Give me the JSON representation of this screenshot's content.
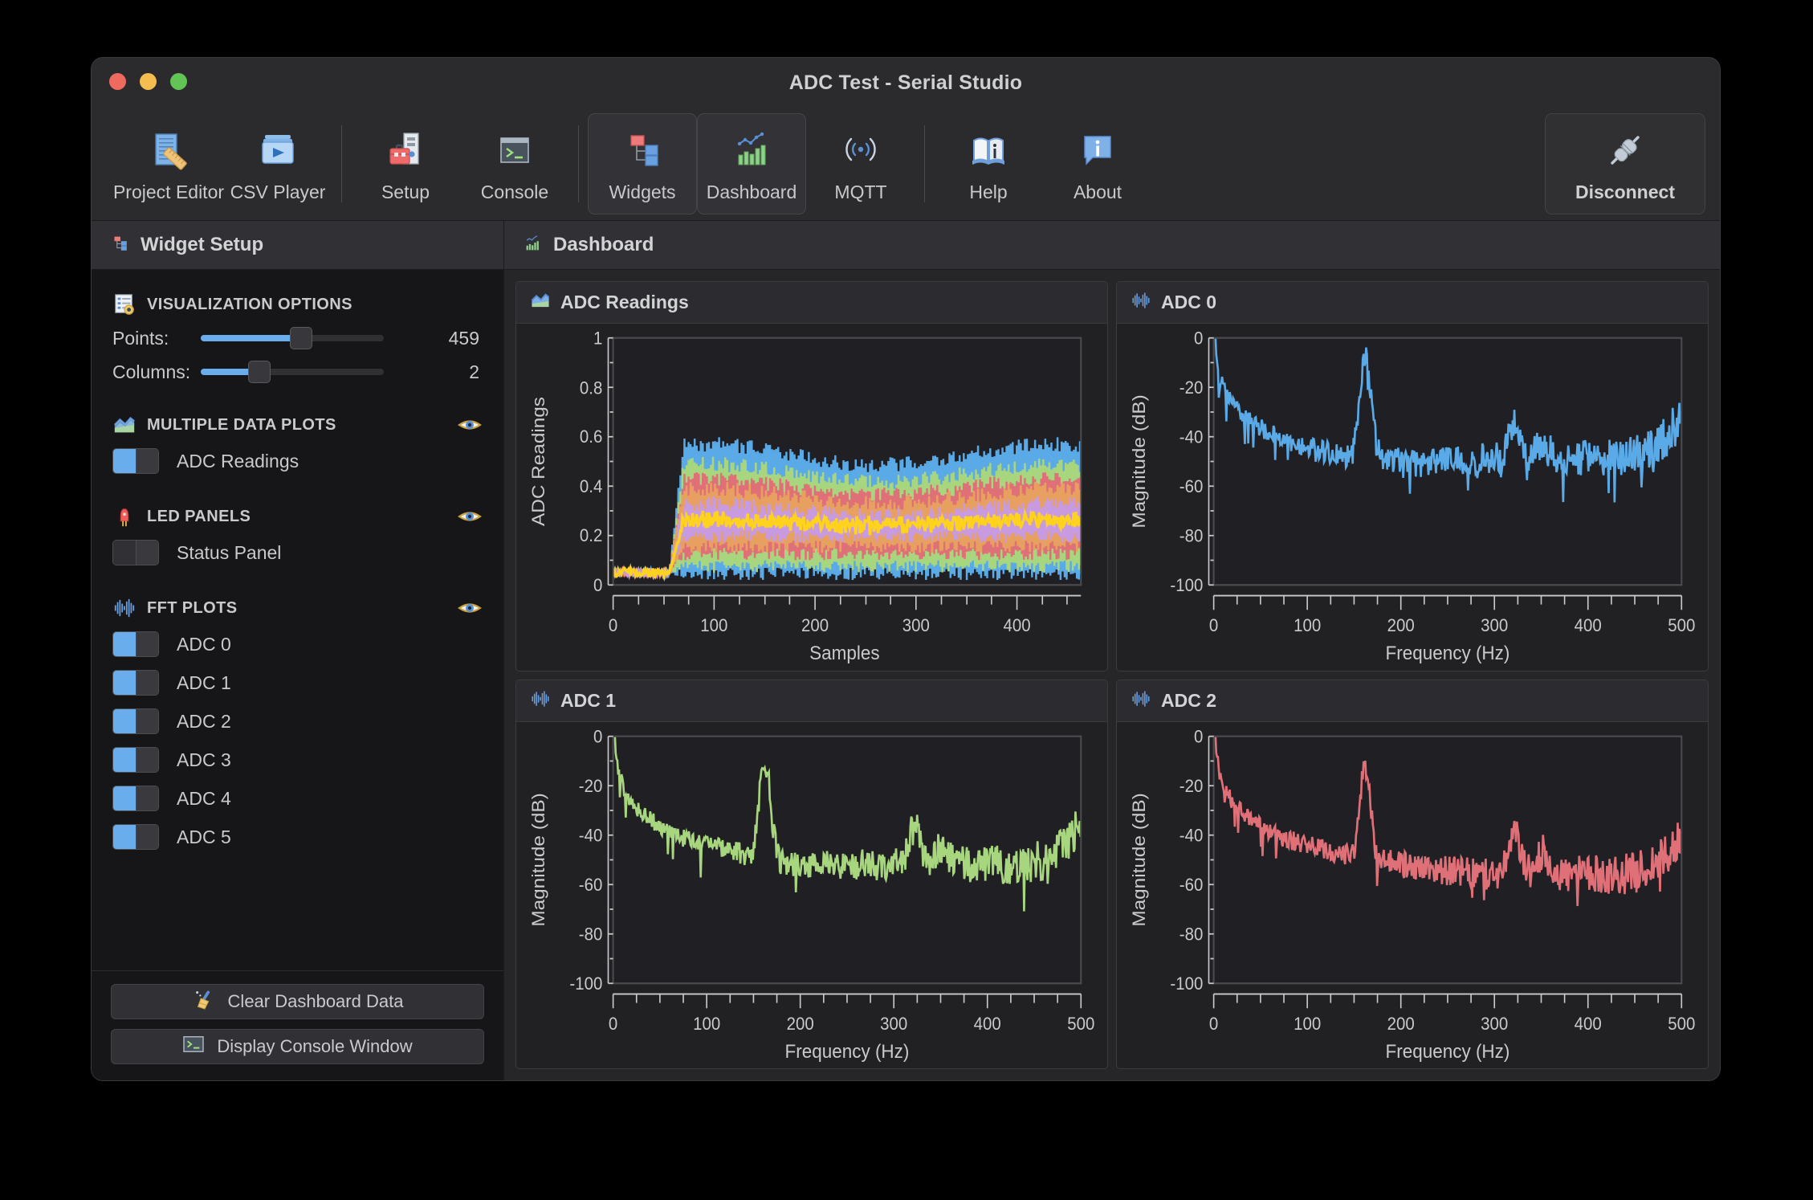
{
  "window": {
    "title": "ADC Test - Serial Studio",
    "traffic_lights": [
      "close",
      "minimize",
      "maximize"
    ]
  },
  "toolbar": {
    "buttons": [
      {
        "label": "Project Editor",
        "icon": "project-editor-icon",
        "active": false
      },
      {
        "label": "CSV Player",
        "icon": "csv-player-icon",
        "active": false
      },
      {
        "label": "Setup",
        "icon": "setup-icon",
        "active": false
      },
      {
        "label": "Console",
        "icon": "console-icon",
        "active": false
      },
      {
        "label": "Widgets",
        "icon": "widgets-icon",
        "active": true
      },
      {
        "label": "Dashboard",
        "icon": "dashboard-icon",
        "active": true
      },
      {
        "label": "MQTT",
        "icon": "mqtt-icon",
        "active": false
      },
      {
        "label": "Help",
        "icon": "help-icon",
        "active": false
      },
      {
        "label": "About",
        "icon": "about-icon",
        "active": false
      }
    ],
    "disconnect": {
      "label": "Disconnect",
      "icon": "connector-icon"
    }
  },
  "panels": {
    "widget_setup_title": "Widget Setup",
    "dashboard_title": "Dashboard"
  },
  "sidebar": {
    "sections": [
      {
        "title": "VISUALIZATION OPTIONS",
        "icon": "visualization-options-icon",
        "eye": false
      },
      {
        "title": "MULTIPLE DATA PLOTS",
        "icon": "multi-plot-icon",
        "eye": true
      },
      {
        "title": "LED PANELS",
        "icon": "led-icon",
        "eye": true
      },
      {
        "title": "FFT PLOTS",
        "icon": "fft-icon",
        "eye": true
      }
    ],
    "sliders": [
      {
        "label": "Points:",
        "value": "459",
        "fill_pct": 55,
        "knob_pct": 55
      },
      {
        "label": "Columns:",
        "value": "2",
        "fill_pct": 32,
        "knob_pct": 32
      }
    ],
    "multiple_data_plots": [
      {
        "label": "ADC Readings",
        "on": true
      }
    ],
    "led_panels": [
      {
        "label": "Status Panel",
        "on": false
      }
    ],
    "fft_plots": [
      {
        "label": "ADC 0",
        "on": true
      },
      {
        "label": "ADC 1",
        "on": true
      },
      {
        "label": "ADC 2",
        "on": true
      },
      {
        "label": "ADC 3",
        "on": true
      },
      {
        "label": "ADC 4",
        "on": true
      },
      {
        "label": "ADC 5",
        "on": true
      }
    ],
    "buttons": [
      {
        "label": "Clear Dashboard Data",
        "icon": "broom-icon"
      },
      {
        "label": "Display Console Window",
        "icon": "console-icon"
      }
    ]
  },
  "dashboard": {
    "cards": [
      {
        "title": "ADC Readings",
        "icon": "multi-plot-icon"
      },
      {
        "title": "ADC 0",
        "icon": "fft-icon"
      },
      {
        "title": "ADC 1",
        "icon": "fft-icon"
      },
      {
        "title": "ADC 2",
        "icon": "fft-icon"
      }
    ]
  },
  "colors": {
    "accent_blue": "#6aadec",
    "series_blue": "#5aaae8",
    "series_green": "#a8d67f",
    "series_red": "#e07078",
    "series_orange": "#e8a060",
    "series_purple": "#c89ae0",
    "series_yellow": "#ffd21e",
    "panel_bg": "#212124",
    "window_bg": "#2b2b2e",
    "sidebar_bg": "#161618"
  },
  "chart_data": [
    {
      "type": "line",
      "title": "ADC Readings",
      "xlabel": "Samples",
      "ylabel": "ADC Readings",
      "xlim": [
        0,
        459
      ],
      "ylim": [
        0,
        1
      ],
      "xticks": [
        0,
        100,
        200,
        300,
        400
      ],
      "yticks": [
        0,
        0.2,
        0.4,
        0.6,
        0.8,
        1
      ],
      "grid": false,
      "legend": "none",
      "note": "Six overlapping noisy ADC channels; flat near 0.05 until ~sample 55, then oscillating band 0.0-0.60 with yellow mean trace near 0.27",
      "series": [
        {
          "name": "ADC 0",
          "color": "#5aaae8",
          "band_low": 0.02,
          "band_high": 0.6,
          "baseline": 0.05
        },
        {
          "name": "ADC 1",
          "color": "#a8d67f",
          "band_low": 0.05,
          "band_high": 0.52,
          "baseline": 0.05
        },
        {
          "name": "ADC 2",
          "color": "#e07078",
          "band_low": 0.1,
          "band_high": 0.46,
          "baseline": 0.05
        },
        {
          "name": "ADC 3",
          "color": "#e8a060",
          "band_low": 0.13,
          "band_high": 0.42,
          "baseline": 0.05
        },
        {
          "name": "ADC 4",
          "color": "#c89ae0",
          "band_low": 0.17,
          "band_high": 0.36,
          "baseline": 0.05
        },
        {
          "name": "ADC 5",
          "color": "#ffd21e",
          "band_low": 0.23,
          "band_high": 0.3,
          "baseline": 0.05
        }
      ]
    },
    {
      "type": "line",
      "title": "ADC 0",
      "xlabel": "Frequency (Hz)",
      "ylabel": "Magnitude (dB)",
      "xlim": [
        0,
        500
      ],
      "ylim": [
        -100,
        0
      ],
      "xticks": [
        0,
        100,
        200,
        300,
        400,
        500
      ],
      "yticks": [
        0,
        -20,
        -40,
        -60,
        -80,
        -100
      ],
      "grid": false,
      "legend": "none",
      "color": "#5aaae8",
      "peaks": [
        {
          "x": 0,
          "y": 0
        },
        {
          "x": 162,
          "y": -8
        },
        {
          "x": 322,
          "y": -34
        },
        {
          "x": 352,
          "y": -43
        },
        {
          "x": 487,
          "y": -40
        }
      ],
      "noise_floor_db": -55
    },
    {
      "type": "line",
      "title": "ADC 1",
      "xlabel": "Frequency (Hz)",
      "ylabel": "Magnitude (dB)",
      "xlim": [
        0,
        500
      ],
      "ylim": [
        -100,
        0
      ],
      "xticks": [
        0,
        100,
        200,
        300,
        400,
        500
      ],
      "yticks": [
        0,
        -20,
        -40,
        -60,
        -80,
        -100
      ],
      "grid": false,
      "legend": "none",
      "color": "#a8d67f",
      "peaks": [
        {
          "x": 0,
          "y": 0
        },
        {
          "x": 162,
          "y": -10
        },
        {
          "x": 322,
          "y": -37
        },
        {
          "x": 352,
          "y": -45
        },
        {
          "x": 487,
          "y": -44
        }
      ],
      "noise_floor_db": -58
    },
    {
      "type": "line",
      "title": "ADC 2",
      "xlabel": "Frequency (Hz)",
      "ylabel": "Magnitude (dB)",
      "xlim": [
        0,
        500
      ],
      "ylim": [
        -100,
        0
      ],
      "xticks": [
        0,
        100,
        200,
        300,
        400,
        500
      ],
      "yticks": [
        0,
        -20,
        -40,
        -60,
        -80,
        -100
      ],
      "grid": false,
      "legend": "none",
      "color": "#e07078",
      "peaks": [
        {
          "x": 0,
          "y": 0
        },
        {
          "x": 162,
          "y": -12
        },
        {
          "x": 322,
          "y": -40
        },
        {
          "x": 352,
          "y": -47
        },
        {
          "x": 487,
          "y": -49
        }
      ],
      "noise_floor_db": -62
    }
  ]
}
